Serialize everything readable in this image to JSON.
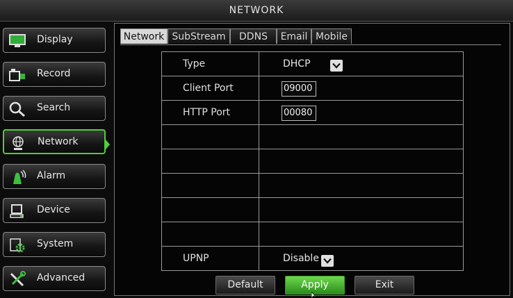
{
  "window": {
    "title": "NETWORK"
  },
  "sidebar": {
    "items": [
      {
        "label": "Display",
        "icon": "monitor-icon"
      },
      {
        "label": "Record",
        "icon": "camera-record-icon"
      },
      {
        "label": "Search",
        "icon": "magnifier-icon"
      },
      {
        "label": "Network",
        "icon": "globe-network-icon",
        "active": true
      },
      {
        "label": "Alarm",
        "icon": "alarm-icon"
      },
      {
        "label": "Device",
        "icon": "device-icon"
      },
      {
        "label": "System",
        "icon": "gear-icon"
      },
      {
        "label": "Advanced",
        "icon": "tools-icon"
      }
    ]
  },
  "tabs": [
    {
      "label": "Network",
      "active": true
    },
    {
      "label": "SubStream"
    },
    {
      "label": "DDNS"
    },
    {
      "label": "Email"
    },
    {
      "label": "Mobile"
    }
  ],
  "form": {
    "type_label": "Type",
    "type_value": "DHCP",
    "client_port_label": "Client Port",
    "client_port_value": "09000",
    "http_port_label": "HTTP Port",
    "http_port_value": "00080",
    "upnp_label": "UPNP",
    "upnp_value": "Disable"
  },
  "buttons": {
    "default_label": "Default",
    "apply_label": "Apply",
    "exit_label": "Exit"
  },
  "colors": {
    "accent": "#4fcf3a",
    "apply_button": "#3fae2e"
  }
}
